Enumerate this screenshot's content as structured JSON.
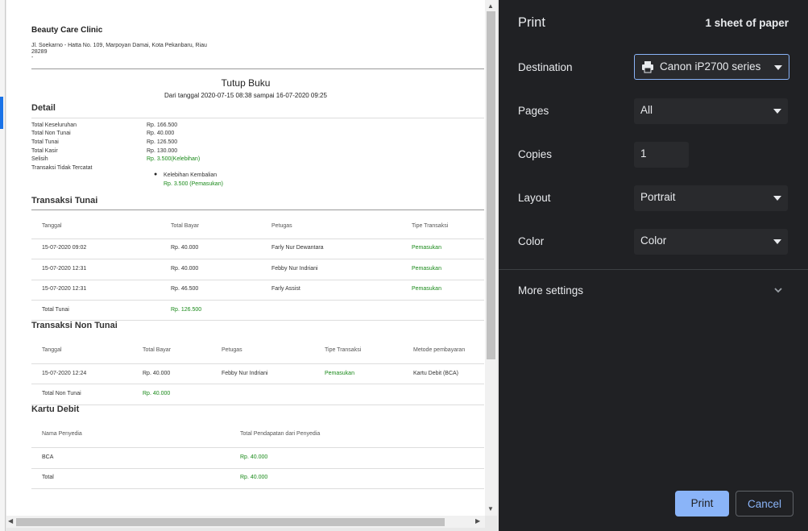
{
  "report": {
    "clinic_name": "Beauty Care Clinic",
    "address_line1": "Jl. Soekarno - Hatta No. 109, Marpoyan Damai, Kota Pekanbaru, Riau",
    "address_line2": "28289",
    "address_line3": "-",
    "title": "Tutup Buku",
    "subtitle": "Dari tanggal 2020-07-15 08:38 sampai 16-07-2020 09:25",
    "detail": {
      "heading": "Detail",
      "rows": [
        {
          "label": "Total Keseluruhan",
          "value": "Rp. 166.500"
        },
        {
          "label": "Total Non Tunai",
          "value": "Rp. 40.000"
        },
        {
          "label": "Total Tunai",
          "value": "Rp. 126.500"
        },
        {
          "label": "Total Kasir",
          "value": "Rp. 130.000"
        },
        {
          "label": "Selisih",
          "value": "Rp. 3.500(Kelebihan)"
        }
      ],
      "untracked_label": "Transaksi Tidak Tercatat",
      "untracked_item": "Kelebihan Kembalian",
      "untracked_value": "Rp. 3.500 (Pemasukan)"
    },
    "cash": {
      "heading": "Transaksi Tunai",
      "headers": [
        "Tanggal",
        "Total Bayar",
        "Petugas",
        "Tipe Transaksi"
      ],
      "rows": [
        [
          "15-07-2020 09:02",
          "Rp. 40.000",
          "Farly Nur Dewantara",
          "Pemasukan"
        ],
        [
          "15-07-2020 12:31",
          "Rp. 40.000",
          "Febby Nur Indriani",
          "Pemasukan"
        ],
        [
          "15-07-2020 12:31",
          "Rp. 46.500",
          "Farly Assist",
          "Pemasukan"
        ]
      ],
      "total_label": "Total Tunai",
      "total_value": "Rp. 126.500"
    },
    "noncash": {
      "heading": "Transaksi Non Tunai",
      "headers": [
        "Tanggal",
        "Total Bayar",
        "Petugas",
        "Tipe Transaksi",
        "Metode pembayaran"
      ],
      "rows": [
        [
          "15-07-2020 12:24",
          "Rp. 40.000",
          "Febby Nur Indriani",
          "Pemasukan",
          "Kartu Debit (BCA)"
        ]
      ],
      "total_label": "Total Non Tunai",
      "total_value": "Rp. 40.000"
    },
    "debit": {
      "heading": "Kartu Debit",
      "headers": [
        "Nama Penyedia",
        "Total Pendapatan dari Penyedia"
      ],
      "rows": [
        [
          "BCA",
          "Rp. 40.000"
        ],
        [
          "Total",
          "Rp. 40.000"
        ]
      ]
    }
  },
  "print_panel": {
    "title": "Print",
    "sheet_count": "1 sheet of paper",
    "destination_label": "Destination",
    "destination_value": "Canon iP2700 series",
    "pages_label": "Pages",
    "pages_value": "All",
    "copies_label": "Copies",
    "copies_value": "1",
    "layout_label": "Layout",
    "layout_value": "Portrait",
    "color_label": "Color",
    "color_value": "Color",
    "more_settings_label": "More settings",
    "print_button": "Print",
    "cancel_button": "Cancel"
  },
  "colors": {
    "panel_bg": "#202124",
    "field_bg": "#292a2d",
    "accent": "#8ab4f8",
    "positive_text": "#1a8a1a"
  },
  "icons": [
    "printer-icon",
    "chevron-down-icon",
    "dropdown-caret-icon"
  ]
}
